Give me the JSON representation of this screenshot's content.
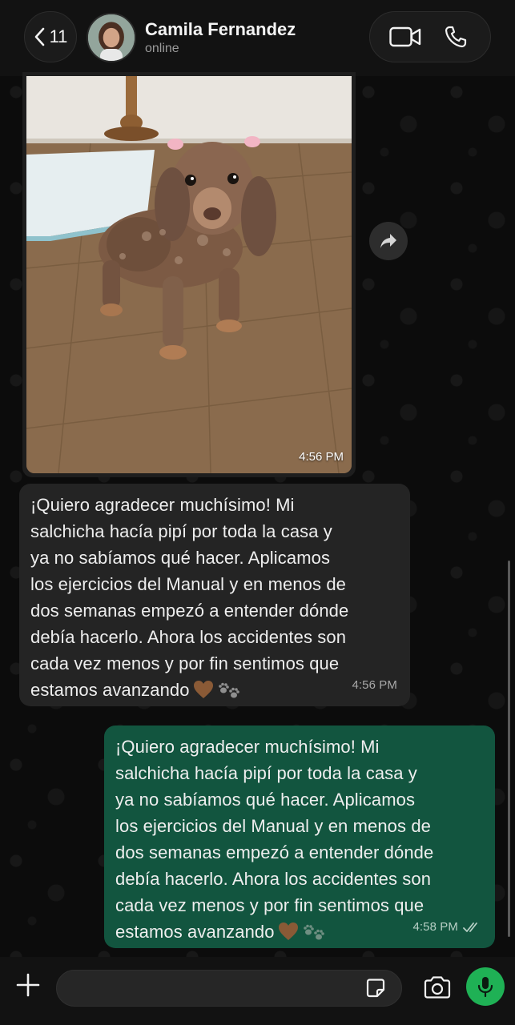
{
  "header": {
    "back_count": "11",
    "contact_name": "Camila Fernandez",
    "contact_status": "online"
  },
  "messages": {
    "image": {
      "time": "4:56 PM"
    },
    "incoming": {
      "text": "¡Quiero agradecer muchísimo! Mi\nsalchicha hacía pipí por toda la casa y\nya no sabíamos qué hacer. Aplicamos\nlos ejercicios del Manual y en menos de\ndos semanas empezó a entender dónde\ndebía hacerlo. Ahora los accidentes son\ncada vez menos y por fin sentimos que\nestamos avanzando",
      "time": "4:56 PM"
    },
    "outgoing": {
      "text": "¡Quiero agradecer muchísimo! Mi\nsalchicha hacía pipí por toda la casa y\nya no sabíamos qué hacer. Aplicamos\nlos ejercicios del Manual y en menos de\ndos semanas empezó a entender dónde\ndebía hacerlo. Ahora los accidentes son\ncada vez menos y por fin sentimos que\nestamos avanzando",
      "time": "4:58 PM",
      "status": "read"
    }
  },
  "icons": {
    "back": "chevron-left-icon",
    "video": "video-camera-icon",
    "phone": "phone-icon",
    "forward": "forward-arrow-icon",
    "plus": "plus-icon",
    "sticker": "sticker-icon",
    "camera": "camera-icon",
    "mic": "microphone-icon",
    "read_receipt": "double-check-icon"
  },
  "colors": {
    "outgoing_bubble": "#12553f",
    "incoming_bubble": "#242424",
    "mic_button": "#1fb155"
  },
  "composer": {
    "value": ""
  }
}
